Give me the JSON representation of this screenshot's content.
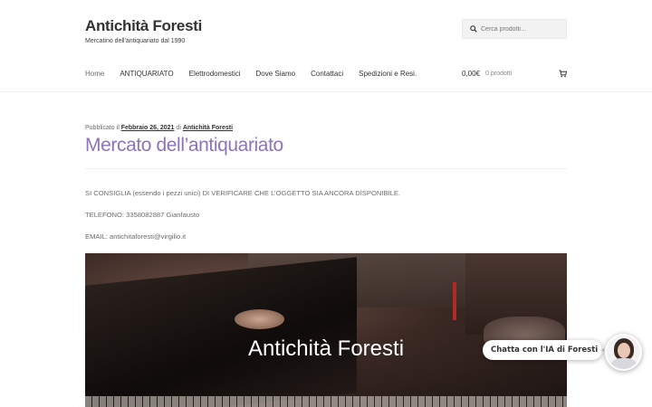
{
  "site": {
    "title": "Antichità Foresti",
    "tagline": "Mercatino dell'antiquariato dal 1990"
  },
  "search": {
    "placeholder": "Cerca prodotti…",
    "icon": "search-icon"
  },
  "nav": {
    "items": [
      {
        "label": "Home"
      },
      {
        "label": "ANTIQUARIATO"
      },
      {
        "label": "Elettrodomestici"
      },
      {
        "label": "Dove Siamo"
      },
      {
        "label": "Contattaci"
      },
      {
        "label": "Spedizioni e Resi."
      }
    ]
  },
  "cart": {
    "amount": "0,00€",
    "count": "0 prodotti",
    "icon": "cart-icon"
  },
  "post": {
    "published_prefix": "Pubblicato il",
    "date": "Febbraio 26, 2021",
    "by": "di",
    "author": "Antichità Foresti",
    "title": "Mercato dell’antiquariato",
    "paragraphs": [
      "SI CONSIGLIA (essendo i pezzi unici) DI VERIFICARE CHE L’OGGETTO SIA ANCORA DISPONIBILE.",
      "TELEFONO: 3358082887 Gianfausto",
      "EMAIL: antichitaforesti@virgilio.it"
    ],
    "hero_title": "Antichità Foresti"
  },
  "chat": {
    "label": "Chatta con l'IA di Foresti",
    "close": "×"
  },
  "colors": {
    "accent": "#8e74b8",
    "heading": "#333333",
    "text": "#6d6d6d"
  }
}
